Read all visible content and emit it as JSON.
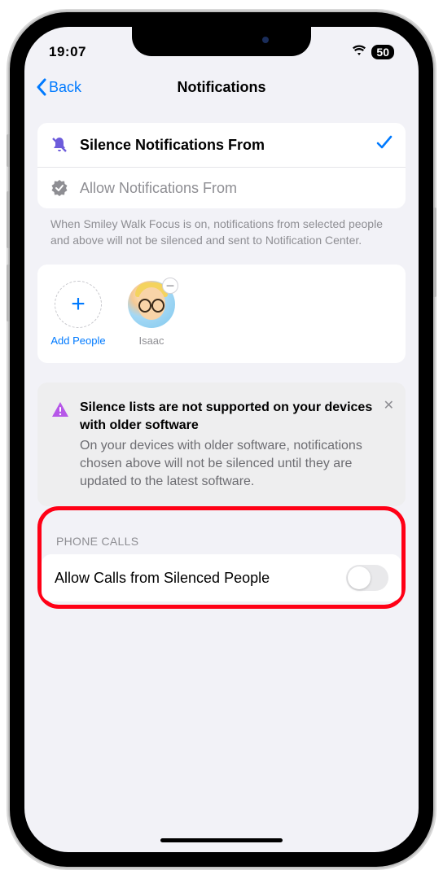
{
  "status": {
    "time": "19:07",
    "battery": "50"
  },
  "nav": {
    "back": "Back",
    "title": "Notifications"
  },
  "options": {
    "silence": "Silence Notifications From",
    "allow": "Allow Notifications From",
    "footer": "When Smiley Walk Focus is on, notifications from selected people and above will not be silenced and sent to Notification Center."
  },
  "people": {
    "add": "Add People",
    "items": [
      {
        "name": "Isaac"
      }
    ]
  },
  "warning": {
    "title": "Silence lists are not supported on your devices with older software",
    "body": "On your devices with older software, notifications chosen above will not be silenced until they are updated to the latest software."
  },
  "phone_calls": {
    "header": "Phone Calls",
    "toggle_label": "Allow Calls from Silenced People",
    "toggle_on": false
  }
}
